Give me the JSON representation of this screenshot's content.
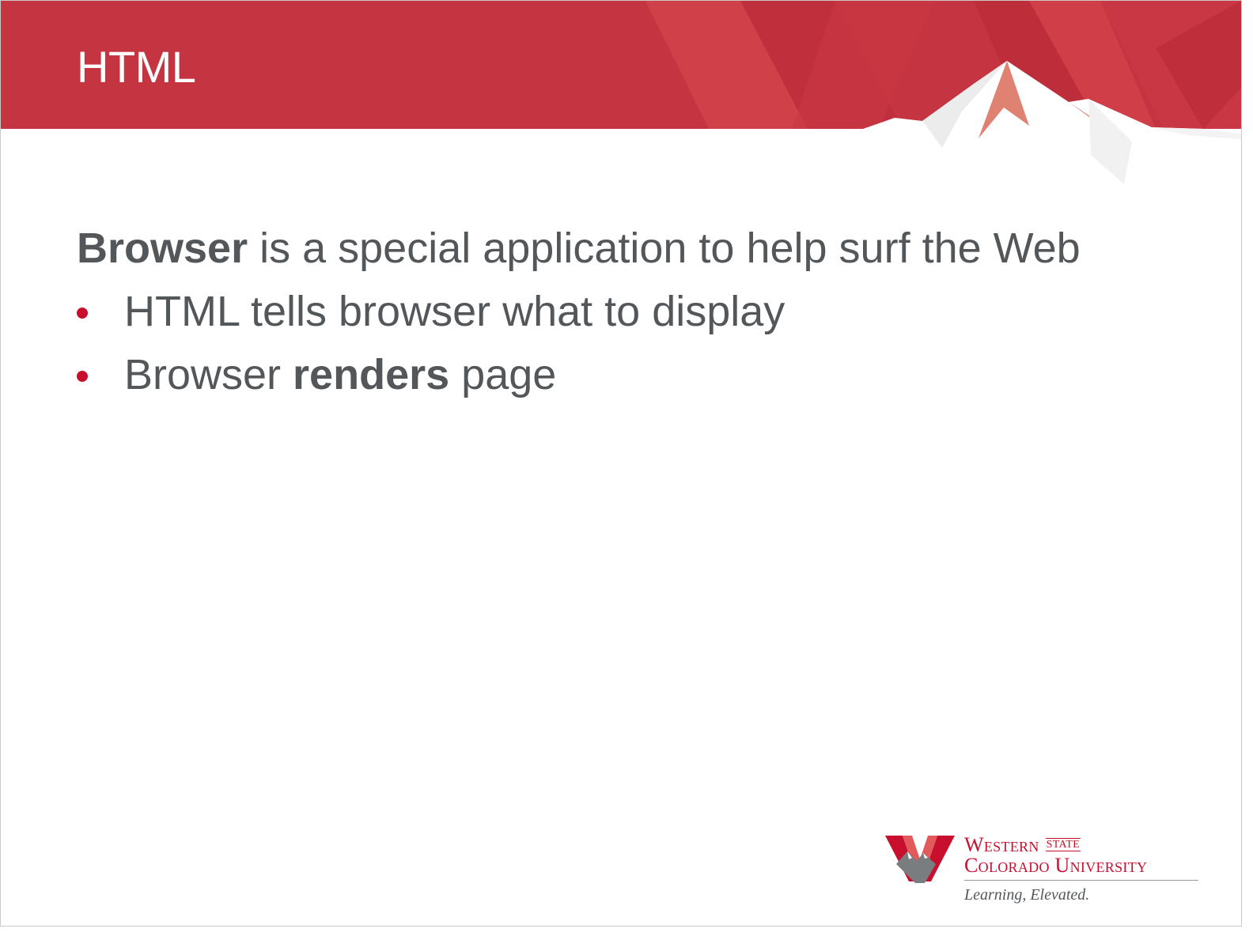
{
  "slide": {
    "title": "HTML",
    "lead": {
      "bold": "Browser",
      "rest": " is a special application to help surf the Web"
    },
    "bullets": [
      {
        "text": "HTML tells browser what to display"
      },
      {
        "pre": "Browser ",
        "bold": "renders",
        "post": " page"
      }
    ]
  },
  "logo": {
    "western": "Western",
    "state": "STATE",
    "university": "Colorado University",
    "tagline": "Learning, Elevated."
  },
  "colors": {
    "banner": "#c53441",
    "accent": "#c8102e",
    "text": "#53575a"
  },
  "icons": [
    "mountain-peak-icon",
    "bullet-icon",
    "university-w-logo-icon"
  ]
}
